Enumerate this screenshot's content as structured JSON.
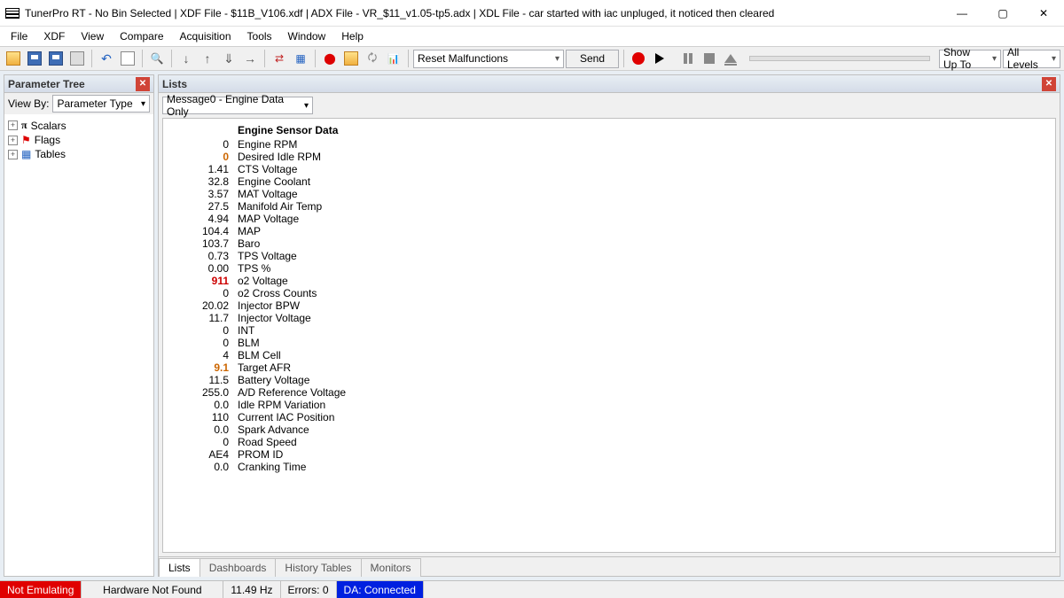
{
  "title": "TunerPro RT - No Bin Selected | XDF File - $11B_V106.xdf | ADX File - VR_$11_v1.05-tp5.adx | XDL File - car started with iac unpluged, it noticed then cleared",
  "menu": [
    "File",
    "XDF",
    "View",
    "Compare",
    "Acquisition",
    "Tools",
    "Window",
    "Help"
  ],
  "toolbar": {
    "reset_label": "Reset Malfunctions",
    "send_label": "Send",
    "showupto_label": "Show Up To",
    "alllevels_label": "All Levels"
  },
  "left": {
    "header": "Parameter Tree",
    "viewby_label": "View By:",
    "viewby_value": "Parameter Type",
    "nodes": [
      {
        "icon": "pi",
        "label": "Scalars"
      },
      {
        "icon": "flag",
        "label": "Flags"
      },
      {
        "icon": "table",
        "label": "Tables"
      }
    ]
  },
  "right": {
    "header": "Lists",
    "select_value": "Message0 - Engine Data Only",
    "list_header": "Engine Sensor Data",
    "rows": [
      {
        "v": "0",
        "n": "Engine RPM",
        "cls": ""
      },
      {
        "v": "0",
        "n": "Desired Idle RPM",
        "cls": "orange"
      },
      {
        "v": "1.41",
        "n": "CTS Voltage",
        "cls": ""
      },
      {
        "v": "32.8",
        "n": "Engine Coolant",
        "cls": ""
      },
      {
        "v": "3.57",
        "n": "MAT Voltage",
        "cls": ""
      },
      {
        "v": "27.5",
        "n": "Manifold Air Temp",
        "cls": ""
      },
      {
        "v": "4.94",
        "n": "MAP Voltage",
        "cls": ""
      },
      {
        "v": "104.4",
        "n": "MAP",
        "cls": ""
      },
      {
        "v": "103.7",
        "n": "Baro",
        "cls": ""
      },
      {
        "v": "0.73",
        "n": "TPS Voltage",
        "cls": ""
      },
      {
        "v": "0.00",
        "n": "TPS %",
        "cls": ""
      },
      {
        "v": "911",
        "n": "o2 Voltage",
        "cls": "red"
      },
      {
        "v": "0",
        "n": "o2 Cross Counts",
        "cls": ""
      },
      {
        "v": "20.02",
        "n": "Injector BPW",
        "cls": ""
      },
      {
        "v": "11.7",
        "n": "Injector Voltage",
        "cls": ""
      },
      {
        "v": "0",
        "n": "INT",
        "cls": ""
      },
      {
        "v": "0",
        "n": "BLM",
        "cls": ""
      },
      {
        "v": "4",
        "n": "BLM Cell",
        "cls": ""
      },
      {
        "v": "9.1",
        "n": "Target AFR",
        "cls": "orange"
      },
      {
        "v": "11.5",
        "n": "Battery Voltage",
        "cls": ""
      },
      {
        "v": "255.0",
        "n": "A/D Reference Voltage",
        "cls": ""
      },
      {
        "v": "0.0",
        "n": "Idle RPM Variation",
        "cls": ""
      },
      {
        "v": "110",
        "n": "Current IAC Position",
        "cls": ""
      },
      {
        "v": "0.0",
        "n": "Spark Advance",
        "cls": ""
      },
      {
        "v": "0",
        "n": "Road Speed",
        "cls": ""
      },
      {
        "v": "AE4",
        "n": "PROM ID",
        "cls": ""
      },
      {
        "v": "0.0",
        "n": "Cranking Time",
        "cls": ""
      }
    ],
    "tabs": [
      "Lists",
      "Dashboards",
      "History Tables",
      "Monitors"
    ]
  },
  "status": {
    "not_emulating": "Not Emulating",
    "hw": "Hardware Not Found",
    "hz": "11.49 Hz",
    "errors": "Errors: 0",
    "da": "DA: Connected"
  }
}
